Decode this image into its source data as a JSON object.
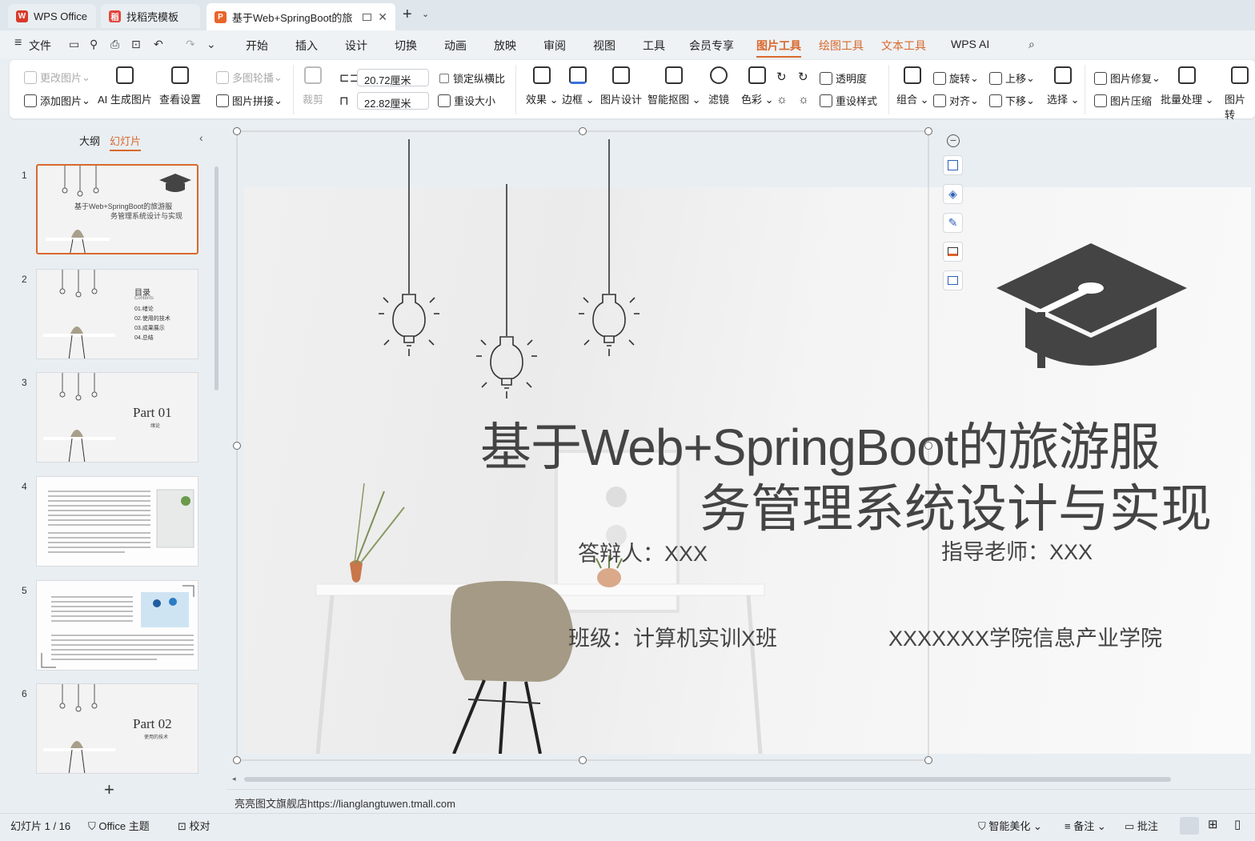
{
  "tabs": [
    {
      "label": "WPS Office"
    },
    {
      "label": "找稻壳模板"
    },
    {
      "label": "基于Web+SpringBoot的旅游"
    }
  ],
  "menu": {
    "file": "文件",
    "items": [
      "开始",
      "插入",
      "设计",
      "切换",
      "动画",
      "放映",
      "审阅",
      "视图",
      "工具",
      "会员专享",
      "图片工具",
      "绘图工具",
      "文本工具",
      "WPS AI"
    ],
    "active": "图片工具"
  },
  "ribbon": {
    "change_pic": "更改图片",
    "add_pic": "添加图片",
    "ai_gen": "AI 生成图片",
    "view_settings": "查看设置",
    "carousel": "多图轮播",
    "stitch": "图片拼接",
    "crop": "裁剪",
    "width": "20.72厘米",
    "height": "22.82厘米",
    "lock_ratio": "锁定纵横比",
    "reset_size": "重设大小",
    "effects": "效果",
    "border": "边框",
    "pic_design": "图片设计",
    "smart_cutout": "智能抠图",
    "filter": "滤镜",
    "color": "色彩",
    "transparency": "透明度",
    "reset_style": "重设样式",
    "group": "组合",
    "rotate": "旋转",
    "align": "对齐",
    "bring_up": "上移",
    "send_down": "下移",
    "select": "选择",
    "repair": "图片修复",
    "compress": "图片压缩",
    "batch": "批量处理",
    "convert": "图片转"
  },
  "panel": {
    "outline_tab": "大纲",
    "slides_tab": "幻灯片",
    "add": "+"
  },
  "thumbnails": [
    {
      "num": "1",
      "title1": "基于Web+SpringBoot的旅游服",
      "title2": "务管理系统设计与实现"
    },
    {
      "num": "2",
      "title": "目录",
      "sub": "Contents",
      "items": [
        "01.绪论",
        "02.使用的技术",
        "03.成果展示",
        "04.总结"
      ]
    },
    {
      "num": "3",
      "title": "Part 01",
      "sub": "绪论"
    },
    {
      "num": "4"
    },
    {
      "num": "5"
    },
    {
      "num": "6",
      "title": "Part 02",
      "sub": "使用的技术"
    }
  ],
  "slide": {
    "title_line1": "基于Web+SpringBoot的旅游服",
    "title_line2": "务管理系统设计与实现",
    "presenter": "答辩人：XXX",
    "advisor": "指导老师：XXX",
    "class": "班级：计算机实训X班",
    "college": "XXXXXXX学院信息产业学院"
  },
  "notes": "亮亮图文旗舰店https://lianglangtuwen.tmall.com",
  "status": {
    "slide_count": "幻灯片 1 / 16",
    "theme": "Office 主题",
    "proof": "校对",
    "beautify": "智能美化",
    "notes_btn": "备注",
    "comment": "批注"
  },
  "colors": {
    "accent": "#d9692e",
    "dark_text": "#444444"
  }
}
